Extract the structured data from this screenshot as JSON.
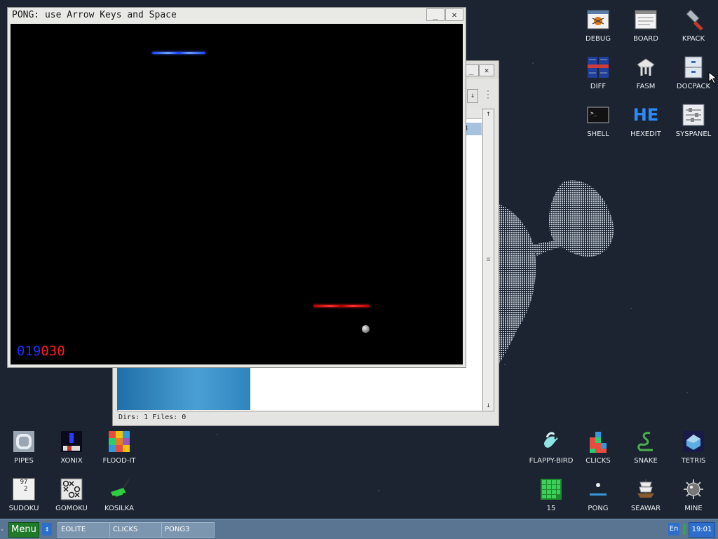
{
  "pong": {
    "title": "PONG: use Arrow Keys and Space",
    "minimize": "_",
    "close": "✕",
    "score_blue": "019",
    "score_red": "030",
    "colors": {
      "blue": "#1a3fff",
      "red": "#ff1a1a",
      "ball": "#999999"
    }
  },
  "file_manager": {
    "status": "Dirs: 1   Files: 0",
    "selected_fragment": "8",
    "minimize": "_",
    "close": "✕",
    "dropdown": "↓",
    "scroll_up": "↑",
    "scroll_down": "↓",
    "scroll_grip": "≡"
  },
  "desktop_right": [
    {
      "label": "DEBUG",
      "icon": "debug-icon"
    },
    {
      "label": "BOARD",
      "icon": "board-icon"
    },
    {
      "label": "KPACK",
      "icon": "kpack-icon"
    },
    {
      "label": "DIFF",
      "icon": "diff-icon"
    },
    {
      "label": "FASM",
      "icon": "fasm-icon"
    },
    {
      "label": "DOCPACK",
      "icon": "docpack-icon"
    },
    {
      "label": "SHELL",
      "icon": "shell-icon"
    },
    {
      "label": "HEXEDIT",
      "icon": "hexedit-icon"
    },
    {
      "label": "SYSPANEL",
      "icon": "syspanel-icon"
    }
  ],
  "desktop_bottom_left": [
    {
      "label": "PIPES",
      "icon": "pipes-icon"
    },
    {
      "label": "XONIX",
      "icon": "xonix-icon"
    },
    {
      "label": "FLOOD-IT",
      "icon": "flood-it-icon"
    },
    {
      "label": "SUDOKU",
      "icon": "sudoku-icon"
    },
    {
      "label": "GOMOKU",
      "icon": "gomoku-icon"
    },
    {
      "label": "KOSILKA",
      "icon": "kosilka-icon"
    }
  ],
  "desktop_bottom_right": [
    {
      "label": "FLAPPY-BIRD",
      "icon": "flappy-bird-icon"
    },
    {
      "label": "CLICKS",
      "icon": "clicks-icon"
    },
    {
      "label": "SNAKE",
      "icon": "snake-icon"
    },
    {
      "label": "TETRIS",
      "icon": "tetris-icon"
    },
    {
      "label": "15",
      "icon": "fifteen-icon"
    },
    {
      "label": "PONG",
      "icon": "pong-icon"
    },
    {
      "label": "SEAWAR",
      "icon": "seawar-icon"
    },
    {
      "label": "MINE",
      "icon": "mine-icon"
    }
  ],
  "hexedit_glyph": "HE",
  "sudoku_glyph": "97\n 2",
  "taskbar": {
    "menu": "Menu",
    "updown": "↕",
    "tasks": [
      "EOLITE",
      "CLICKS",
      "PONG3"
    ],
    "lang": "En",
    "clock": "19:01",
    "edge": "◂"
  }
}
